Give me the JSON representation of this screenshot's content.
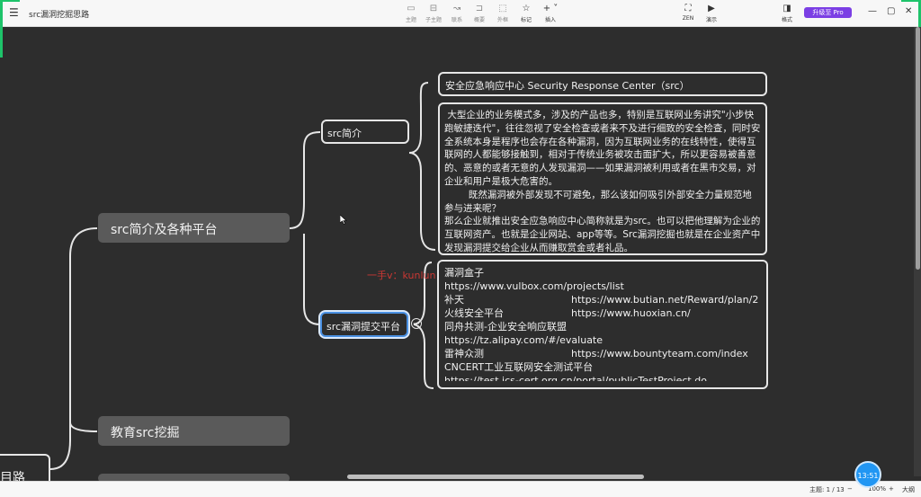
{
  "app": {
    "title": "src漏洞挖掘思路"
  },
  "toolbar": {
    "items": [
      {
        "label": "主题",
        "icon": "topic-icon"
      },
      {
        "label": "子主题",
        "icon": "subtopic-icon"
      },
      {
        "label": "联系",
        "icon": "relation-icon"
      },
      {
        "label": "概要",
        "icon": "summary-icon"
      },
      {
        "label": "外框",
        "icon": "boundary-icon"
      },
      {
        "label": "标记",
        "icon": "star-icon"
      },
      {
        "label": "插入",
        "icon": "plus-icon"
      }
    ],
    "right_items": [
      {
        "label": "ZEN",
        "icon": "fullscreen-icon"
      },
      {
        "label": "演示",
        "icon": "present-icon"
      },
      {
        "label": "格式",
        "icon": "format-panel-icon"
      }
    ],
    "pro_label": "升级至 Pro"
  },
  "map": {
    "branch1": "src简介及各种平台",
    "branch2": "教育src挖掘",
    "root_partial": "目路",
    "sub1": "src简介",
    "sub2": "src漏洞提交平台",
    "leaf_title": "安全应急响应中心 Security Response Center（src）",
    "leaf_text": " 大型企业的业务模式多，涉及的产品也多，特别是互联网业务讲究\"小步快跑敏捷迭代\"，往往忽视了安全检查或者来不及进行细致的安全检查，同时安全系统本身是程序也会存在各种漏洞，因为互联网业务的在线特性，使得互联网的人都能够接触到，相对于传统业务被攻击面扩大，所以更容易被善意的、恶意的或者无意的人发现漏洞——如果漏洞被利用或者在黑市交易，对企业和用户是极大危害的。\n        既然漏洞被外部发现不可避免，那么该如何吸引外部安全力量规范地参与进来呢？\n那么企业就推出安全应急响应中心简称就是为src。也可以把他理解为企业的互联网资产。也就是企业网站、app等等。Src漏洞挖掘也就是在企业资产中发现漏洞提交给企业从而赚取赏金或者礼品。",
    "platforms_title": "漏洞盒子",
    "platforms": [
      {
        "a": "https://www.vulbox.com/projects/list",
        "b": ""
      },
      {
        "a": "补天",
        "b": "https://www.butian.net/Reward/plan/2"
      },
      {
        "a": "火线安全平台",
        "b": "https://www.huoxian.cn/"
      },
      {
        "a": "同舟共测-企业安全响应联盟",
        "b": ""
      },
      {
        "a": "https://tz.alipay.com/#/evaluate",
        "b": ""
      },
      {
        "a": "雷神众测",
        "b": "https://www.bountyteam.com/index"
      },
      {
        "a": "CNCERT工业互联网安全测试平台",
        "b": ""
      },
      {
        "a": "https://test.ics-cert.org.cn/portal/publicTestProject.do",
        "b": ""
      }
    ],
    "collapse_symbol": "−"
  },
  "watermark": "一手v：kunlun",
  "status": {
    "topics": "主题: 1 / 13",
    "zoom": "100%",
    "size_label": "大纲",
    "timer": "13:51"
  },
  "colors": {
    "canvas": "#2d2d2d",
    "accent": "#1ec36a",
    "pro": "#7b3fe4"
  }
}
